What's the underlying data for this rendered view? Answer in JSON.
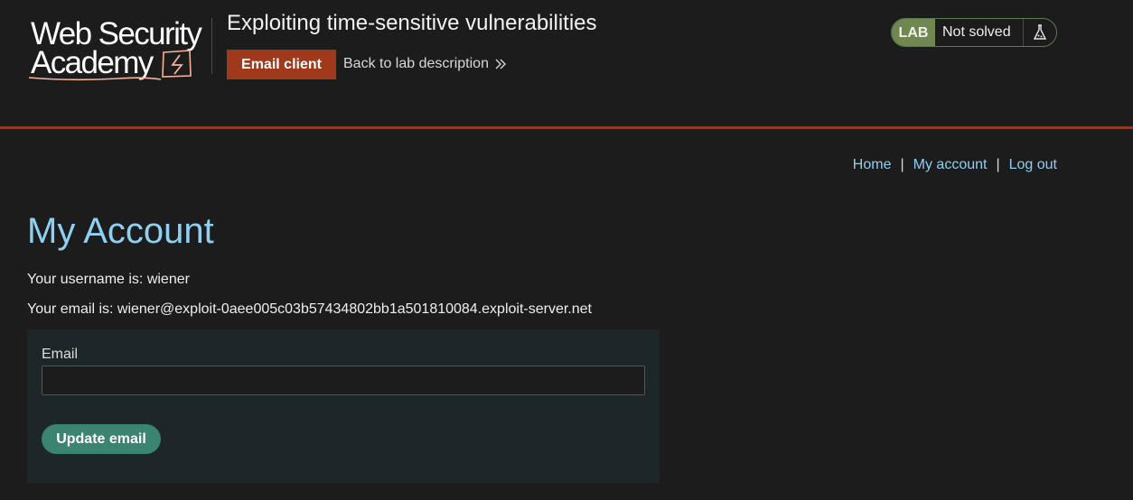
{
  "header": {
    "logo": {
      "line1": "Web Security",
      "line2": "Academy"
    },
    "lab_title": "Exploiting time-sensitive vulnerabilities",
    "email_client_label": "Email client",
    "back_link_label": "Back to lab description",
    "lab_badge": {
      "tag": "LAB",
      "status": "Not solved",
      "icon": "flask-icon"
    }
  },
  "nav": {
    "home": "Home",
    "my_account": "My account",
    "log_out": "Log out",
    "separator": "|"
  },
  "main": {
    "title": "My Account",
    "username_line": "Your username is: wiener",
    "email_line": "Your email is: wiener@exploit-0aee005c03b57434802bb1a501810084.exploit-server.net",
    "form": {
      "email_label": "Email",
      "email_value": "",
      "submit_label": "Update email"
    }
  },
  "colors": {
    "accent_orange": "#a0391b",
    "link_blue": "#8fcff2",
    "lab_green": "#70884f",
    "button_teal": "#3b8471"
  }
}
